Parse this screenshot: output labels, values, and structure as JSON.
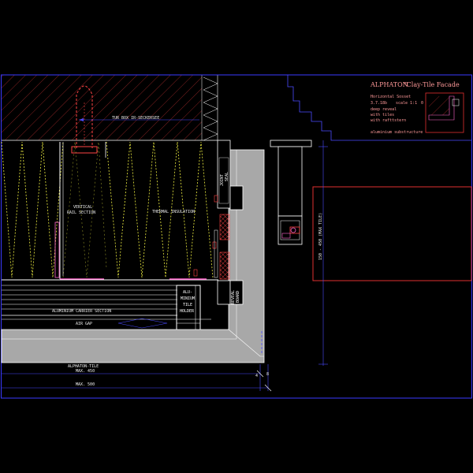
{
  "title_block": {
    "brand": "ALPHATON",
    "product": "\"Clay-Tile Facade",
    "line1": "Horizontal Sosset",
    "line2_date": "3.7.18b",
    "line2_scale": "scale 1:1",
    "line2_code": "0",
    "line3": "deep reveal",
    "line4": "with tiles",
    "line5": "with rafttstern",
    "line6": "aluminium substructure"
  },
  "labels": {
    "wall_anchor": "TUR BOX IR-SECKERSEE",
    "vertical_rail": [
      "VERTICAL",
      "RAIL SECTION"
    ],
    "insulation": "THERMAL INSULATION",
    "joint_seal": [
      "JOINT",
      "SEAL"
    ],
    "rail_profile": "ALUMINIUM CARRIER SECTION",
    "air_gap": "AIR GAP",
    "tile_holder": [
      "ALU-",
      "MINIUM",
      "TILE",
      "HOLDER"
    ],
    "reveal_tile": [
      "REVEAL",
      "BOARD"
    ],
    "window_dim": "150 - 450 (MAX TILE)",
    "facade_tile": [
      "ALPHATON-TILE",
      "MAX. 450"
    ],
    "overall_dim": "MAX. 500",
    "small_dim_left": "4",
    "small_dim_right": "8"
  },
  "colors": {
    "background": "#000000",
    "frame": "#3a3aff",
    "dimension": "#4a4aff",
    "hatch": "#b03030",
    "insulation": "#f0f040",
    "tile": "#a8a8a8",
    "red": "#e03030",
    "magenta": "#ff66cc",
    "white": "#ffffff",
    "pink": "#ff9999"
  }
}
